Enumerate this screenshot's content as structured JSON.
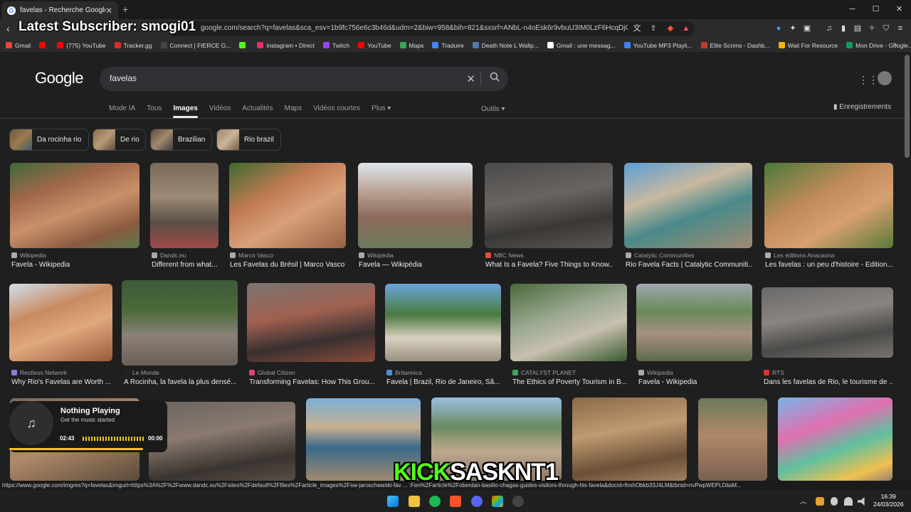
{
  "browser": {
    "tab_title": "favelas - Recherche Google",
    "tab_close": "✕",
    "new_tab": "+",
    "url": "google.com/search?q=favelas&sca_esv=1b9fc756e6c3b46d&udm=2&biw=958&bih=821&sxsrf=ANbL-n4oEsk6r9vbuU3IM0LzF6HcqDjOAw%3...",
    "window_controls": [
      "─",
      "☐",
      "✕"
    ]
  },
  "overlay": {
    "subscriber": "Latest Subscriber: smogi01",
    "kick_a": "KICK",
    "kick_b": "SASKNT1"
  },
  "bookmarks": [
    {
      "label": "Gmail",
      "color": "#ea4335"
    },
    {
      "label": "",
      "color": "#ff0000"
    },
    {
      "label": "(775) YouTube",
      "color": "#ff0000"
    },
    {
      "label": "Tracker.gg",
      "color": "#d32f2f"
    },
    {
      "label": "Connect | FIERCE G...",
      "color": "#444444"
    },
    {
      "label": "",
      "color": "#53fc18"
    },
    {
      "label": "Instagram • Direct",
      "color": "#e1306c"
    },
    {
      "label": "Twitch",
      "color": "#9146ff"
    },
    {
      "label": "YouTube",
      "color": "#ff0000"
    },
    {
      "label": "Maps",
      "color": "#34a853"
    },
    {
      "label": "Traduire",
      "color": "#4285f4"
    },
    {
      "label": "Death Note L Wallp...",
      "color": "#5577aa"
    },
    {
      "label": "Gmail : une messag...",
      "color": "#ffffff"
    },
    {
      "label": "YouTube MP3 Playli...",
      "color": "#3b82f6"
    },
    {
      "label": "Elite Scrims - Dashb...",
      "color": "#c0392b"
    },
    {
      "label": "Wait For Resource",
      "color": "#f4b400"
    },
    {
      "label": "Mon Drive - Google...",
      "color": "#0f9d58"
    }
  ],
  "google": {
    "logo": "Google",
    "query": "favelas",
    "tabs": [
      "Mode IA",
      "Tous",
      "Images",
      "Vidéos",
      "Actualités",
      "Maps",
      "Vidéos courtes",
      "Plus ▾"
    ],
    "active_tab": "Images",
    "tools": "Outils ▾",
    "saved": "Enregistrements"
  },
  "chips": [
    "Da rocinha rio",
    "De rio",
    "Brazilian",
    "Rio brazil"
  ],
  "results": [
    {
      "source": "Wikipedia",
      "title": "Favela - Wikipedia"
    },
    {
      "source": "Dandc.eu",
      "title": "Different from what..."
    },
    {
      "source": "Marco Vasco",
      "title": "Les Favelas du Brésil | Marco Vasco"
    },
    {
      "source": "Wikipédia",
      "title": "Favela — Wikipédia"
    },
    {
      "source": "NBC News",
      "title": "What Is a Favela? Five Things to Know..."
    },
    {
      "source": "Catalytic Communities",
      "title": "Rio Favela Facts | Catalytic Communiti..."
    },
    {
      "source": "Les éditions Anacaona",
      "title": "Les favelas : un peu d'histoire - Edition..."
    },
    {
      "source": "Restless Network",
      "title": "Why Rio's Favelas are Worth ..."
    },
    {
      "source": "Le Monde",
      "title": "A Rocinha, la favela la plus densé..."
    },
    {
      "source": "Global Citizen",
      "title": "Transforming Favelas: How This Grou..."
    },
    {
      "source": "Britannica",
      "title": "Favela | Brazil, Rio de Janeiro, Sã..."
    },
    {
      "source": "CATALYST PLANET",
      "title": "The Ethics of Poverty Tourism in B..."
    },
    {
      "source": "Wikipedia",
      "title": "Favela - Wikipedia"
    },
    {
      "source": "RTS",
      "title": "Dans les favelas de Rio, le tourisme de ..."
    }
  ],
  "music": {
    "title": "Nothing Playing",
    "subtitle": "Get the music started",
    "elapsed": "02:43",
    "remaining": "00:00"
  },
  "status_url": "https://www.google.com/imgres?q=favelas&imgurl=https%3A%2F%2Fwww.dandc.eu%2Fsites%2Fdefault%2Ffiles%2Farticle_images%2Fsw-jaroschewski-fav  ...  :Fen%2Farticle%2Foberdan-basilio-chagas-guides-visitors-through-his-favela&docid=fnxhObkb33J4LM&tbnid=nvPwpWEPLDliaM...",
  "clock": {
    "time": "16:39",
    "date": "24/03/2026"
  }
}
